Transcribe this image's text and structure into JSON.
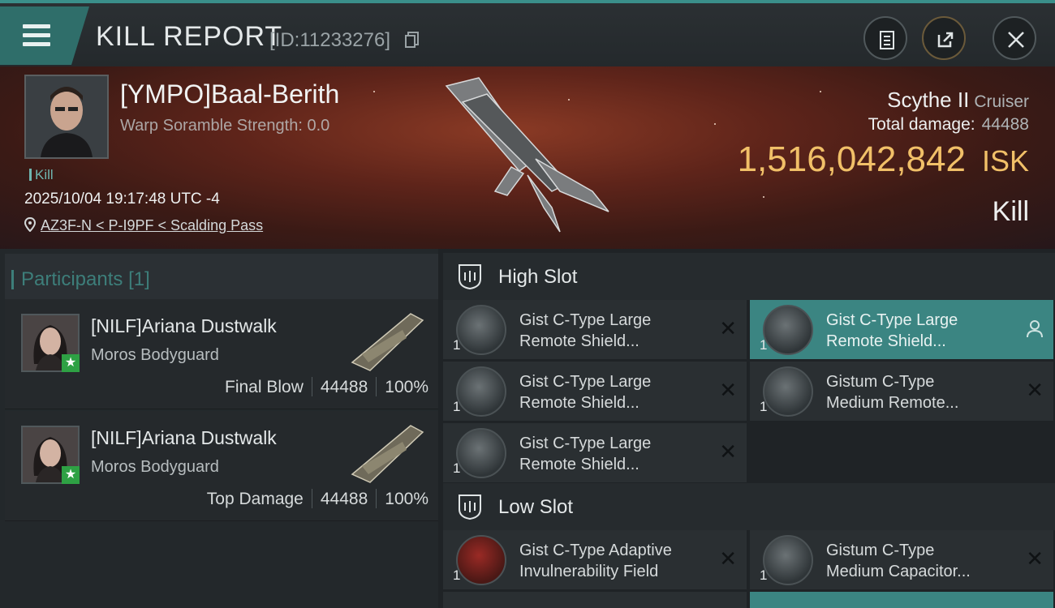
{
  "header": {
    "title": "KILL REPORT",
    "kill_id": "[ID:11233276]",
    "icons": [
      "menu-icon",
      "copy-icon",
      "clipboard-icon",
      "share-icon",
      "close-icon"
    ]
  },
  "victim": {
    "name": "[YMPO]Baal-Berith",
    "warp_scramble": "Warp Soramble Strength: 0.0",
    "kill_tag": "Kill",
    "timestamp": "2025/10/04 19:17:48 UTC -4",
    "location": "AZ3F-N < P-I9PF < Scalding Pass",
    "ship_name": "Scythe II",
    "ship_class": "Cruiser",
    "total_damage_label": "Total damage:",
    "total_damage_value": "44488",
    "isk_value": "1,516,042,842",
    "isk_currency": "ISK",
    "result": "Kill"
  },
  "participants": {
    "header": "Participants",
    "count": "[1]",
    "rows": [
      {
        "name": "[NILF]Ariana Dustwalk",
        "ship": "Moros Bodyguard",
        "label": "Final Blow",
        "damage": "44488",
        "percent": "100%"
      },
      {
        "name": "[NILF]Ariana Dustwalk",
        "ship": "Moros Bodyguard",
        "label": "Top Damage",
        "damage": "44488",
        "percent": "100%"
      }
    ]
  },
  "slots": {
    "high": {
      "label": "High Slot",
      "modules": [
        {
          "qty": "1",
          "line1": "Gist C-Type Large",
          "line2": "Remote Shield...",
          "icon": "shield-booster-icon"
        },
        {
          "qty": "1",
          "line1": "Gist C-Type Large",
          "line2": "Remote Shield...",
          "icon": "shield-booster-icon",
          "highlight": true,
          "action_icon": "person-icon"
        },
        {
          "qty": "1",
          "line1": "Gist C-Type Large",
          "line2": "Remote Shield...",
          "icon": "shield-booster-icon"
        },
        {
          "qty": "1",
          "line1": "Gistum C-Type",
          "line2": "Medium Remote...",
          "icon": "shield-booster-icon"
        },
        {
          "qty": "1",
          "line1": "Gist C-Type Large",
          "line2": "Remote Shield...",
          "icon": "shield-booster-icon"
        }
      ]
    },
    "low": {
      "label": "Low Slot",
      "modules": [
        {
          "qty": "1",
          "line1": "Gist C-Type Adaptive",
          "line2": "Invulnerability Field",
          "icon": "invulnerability-field-icon"
        },
        {
          "qty": "1",
          "line1": "Gistum C-Type",
          "line2": "Medium Capacitor...",
          "icon": "capacitor-booster-icon"
        }
      ]
    }
  },
  "colors": {
    "accent": "#3b8582",
    "isk": "#f1c068",
    "hero_bg": "#5e241a"
  }
}
